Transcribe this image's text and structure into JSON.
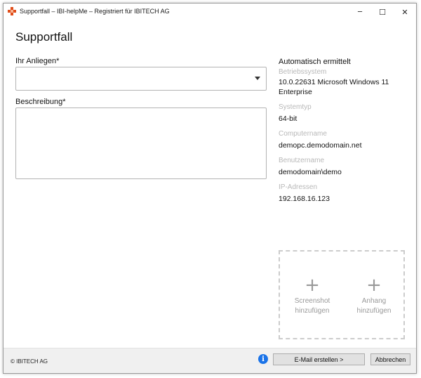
{
  "window": {
    "title": "Supportfall – IBI-helpMe – Registriert für IBITECH AG",
    "minimize_glyph": "─",
    "maximize_glyph": "☐",
    "close_glyph": "✕"
  },
  "page": {
    "heading": "Supportfall"
  },
  "form": {
    "concern_label": "Ihr Anliegen*",
    "concern_value": "",
    "description_label": "Beschreibung*",
    "description_value": ""
  },
  "auto_info": {
    "title": "Automatisch ermittelt",
    "os_label": "Betriebssystem",
    "os_value": "10.0.22631 Microsoft Windows 11 Enterprise",
    "systype_label": "Systemtyp",
    "systype_value": "64-bit",
    "computer_label": "Computername",
    "computer_value": "demopc.demodomain.net",
    "user_label": "Benutzername",
    "user_value": "demodomain\\demo",
    "ip_label": "IP-Adressen",
    "ip_value": "192.168.16.123"
  },
  "attachments": {
    "plus_glyph": "+",
    "screenshot_line1": "Screenshot",
    "screenshot_line2": "hinzufügen",
    "attachment_line1": "Anhang",
    "attachment_line2": "hinzufügen"
  },
  "footer": {
    "copyright": "© IBITECH AG",
    "info_glyph": "i",
    "email_button": "E-Mail erstellen >",
    "cancel_button": "Abbrechen"
  },
  "colors": {
    "accent": "#1a73e8",
    "app_icon": "#e04e1b"
  }
}
